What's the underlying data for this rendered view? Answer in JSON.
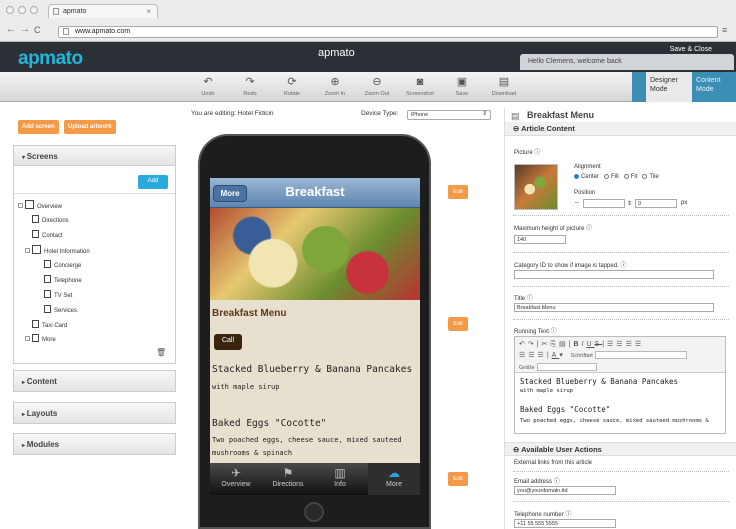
{
  "browser": {
    "tab_title": "apmato",
    "url": "www.apmato.com"
  },
  "header": {
    "logo": "apmato",
    "title": "apmato",
    "save_close": "Save & Close",
    "greeting": "Hello Clemens, welcome back"
  },
  "toolbar": [
    {
      "label": "Undo",
      "icon": "undo-icon",
      "glyph": "↶"
    },
    {
      "label": "Redo",
      "icon": "redo-icon",
      "glyph": "↷"
    },
    {
      "label": "Rotate",
      "icon": "rotate-icon",
      "glyph": "⟳"
    },
    {
      "label": "Zoom In",
      "icon": "zoom-in-icon",
      "glyph": "⊕"
    },
    {
      "label": "Zoom Out",
      "icon": "zoom-out-icon",
      "glyph": "⊖"
    },
    {
      "label": "Screenshot",
      "icon": "camera-icon",
      "glyph": "◙"
    },
    {
      "label": "Save",
      "icon": "save-icon",
      "glyph": "▣"
    },
    {
      "label": "Download",
      "icon": "download-icon",
      "glyph": "▤"
    }
  ],
  "modes": {
    "designer": "Designer Mode",
    "content": "Content Mode"
  },
  "sidebar": {
    "add_screen": "Add screen",
    "upload_artwork": "Upload artwork",
    "screens_title": "Screens",
    "add": "Add",
    "tree": [
      "Overview",
      "Directions",
      "Contact",
      "Hotel Information",
      "Concierge",
      "Telephone",
      "TV Set",
      "Services",
      "Taxi Card",
      "More"
    ],
    "content_title": "Content",
    "layouts_title": "Layouts",
    "modules_title": "Modules"
  },
  "editor": {
    "editing": "You are editing: Hotel Fidicin",
    "device_label": "Device Type:",
    "device_value": "iPhone",
    "edit": "Edit"
  },
  "phone": {
    "back": "More",
    "title": "Breakfast",
    "menu_title": "Breakfast Menu",
    "call": "Call",
    "item1": "Stacked Blueberry & Banana Pancakes",
    "item1_sub": "with maple sirup",
    "item2": "Baked Eggs \"Cocotte\"",
    "item2_sub": "Two poached eggs, cheese sauce, mixed sauteed mushrooms & spinach",
    "tabs": [
      "Overview",
      "Directions",
      "Info",
      "More"
    ]
  },
  "right": {
    "title": "Breakfast Menu",
    "article_content": "Article Content",
    "picture": "Picture",
    "alignment": "Alignment",
    "align_options": [
      "Center",
      "Fill",
      "Fit",
      "Tile"
    ],
    "position": "Position",
    "pos_x": "",
    "pos_y": "0",
    "px": "px",
    "max_height": "Maximum height of picture",
    "max_height_value": "140",
    "category": "Category ID to show if image is tapped.",
    "title_label": "Title",
    "title_value": "Breakfast Menu",
    "running_text": "Running Text",
    "font_label": "Schriftart",
    "size_label": "Größe",
    "rte_item1": "Stacked Blueberry & Banana Pancakes",
    "rte_item1_sub": "with maple sirup",
    "rte_item2": "Baked Eggs \"Cocotte\"",
    "rte_item2_sub": "Two poached eggs, cheese sauce, mixed sauteed mushrooms &",
    "user_actions": "Available User Actions",
    "external_links": "External links from this article",
    "email_label": "Email address",
    "email_value": "you@yourdomain.tld",
    "phone_label": "Telephone number",
    "phone_value": "+11 55 555 5555"
  },
  "colors": {
    "brand": "#25b4d6",
    "orange": "#f39a48",
    "header": "#2b3036"
  }
}
